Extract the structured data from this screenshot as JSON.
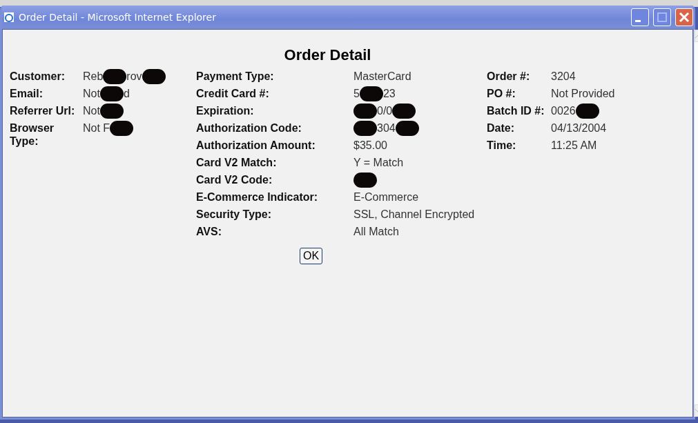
{
  "window": {
    "title": "Order Detail - Microsoft Internet Explorer"
  },
  "heading": "Order Detail",
  "columns": [
    {
      "fields": [
        {
          "label": "Customer:",
          "parts": [
            {
              "kind": "text",
              "text": "Reb"
            },
            {
              "kind": "redaction"
            },
            {
              "kind": "text",
              "text": "rov"
            },
            {
              "kind": "redaction"
            }
          ]
        },
        {
          "label": "Email:",
          "parts": [
            {
              "kind": "text",
              "text": "Not"
            },
            {
              "kind": "redaction"
            },
            {
              "kind": "text",
              "text": "d"
            }
          ]
        },
        {
          "label": "Referrer Url:",
          "parts": [
            {
              "kind": "text",
              "text": "Not"
            },
            {
              "kind": "redaction"
            }
          ]
        },
        {
          "label": "Browser Type:",
          "parts": [
            {
              "kind": "text",
              "text": "Not F"
            },
            {
              "kind": "redaction"
            }
          ]
        }
      ]
    },
    {
      "fields": [
        {
          "label": "Payment Type:",
          "parts": [
            {
              "kind": "text",
              "text": "MasterCard"
            }
          ]
        },
        {
          "label": "Credit Card #:",
          "parts": [
            {
              "kind": "text",
              "text": "5"
            },
            {
              "kind": "redaction"
            },
            {
              "kind": "text",
              "text": "23"
            }
          ]
        },
        {
          "label": "Expiration:",
          "parts": [
            {
              "kind": "redaction"
            },
            {
              "kind": "text",
              "text": "0/0"
            },
            {
              "kind": "redaction"
            }
          ]
        },
        {
          "label": "Authorization Code:",
          "parts": [
            {
              "kind": "redaction"
            },
            {
              "kind": "text",
              "text": "304"
            },
            {
              "kind": "redaction"
            }
          ]
        },
        {
          "label": "Authorization Amount:",
          "parts": [
            {
              "kind": "text",
              "text": "$35.00"
            }
          ]
        },
        {
          "label": "Card V2 Match:",
          "parts": [
            {
              "kind": "text",
              "text": "Y = Match"
            }
          ]
        },
        {
          "label": "Card V2 Code:",
          "parts": [
            {
              "kind": "redaction"
            }
          ]
        },
        {
          "label": "E-Commerce Indicator:",
          "parts": [
            {
              "kind": "text",
              "text": "E-Commerce"
            }
          ]
        },
        {
          "label": "Security Type:",
          "parts": [
            {
              "kind": "text",
              "text": "SSL, Channel Encrypted"
            }
          ]
        },
        {
          "label": "AVS:",
          "parts": [
            {
              "kind": "text",
              "text": "All Match"
            }
          ]
        }
      ]
    },
    {
      "fields": [
        {
          "label": "Order #:",
          "parts": [
            {
              "kind": "text",
              "text": "3204"
            }
          ]
        },
        {
          "label": "PO #:",
          "parts": [
            {
              "kind": "text",
              "text": "Not Provided"
            }
          ]
        },
        {
          "label": "Batch ID #:",
          "parts": [
            {
              "kind": "text",
              "text": "0026"
            },
            {
              "kind": "redaction"
            }
          ]
        },
        {
          "label": "Date:",
          "parts": [
            {
              "kind": "text",
              "text": "04/13/2004"
            }
          ]
        },
        {
          "label": "Time:",
          "parts": [
            {
              "kind": "text",
              "text": "11:25 AM"
            }
          ]
        }
      ]
    }
  ],
  "ok_button": "OK"
}
